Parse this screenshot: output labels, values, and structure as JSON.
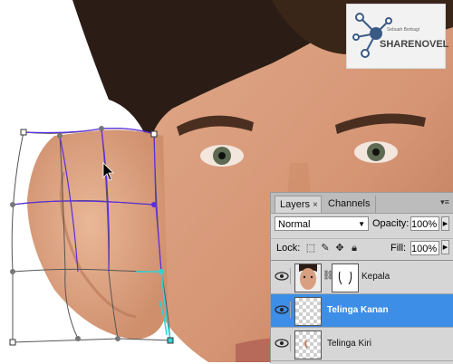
{
  "watermark": {
    "brand": "SHARENOVEL",
    "tagline": "Sebuah Berbagi"
  },
  "layers_panel": {
    "tabs": [
      {
        "label": "Layers",
        "close": "×"
      },
      {
        "label": "Channels"
      }
    ],
    "blend_mode": "Normal",
    "opacity_label": "Opacity:",
    "opacity_value": "100%",
    "lock_label": "Lock:",
    "fill_label": "Fill:",
    "fill_value": "100%",
    "layers": [
      {
        "name": "Kepala",
        "visible": true,
        "selected": false,
        "has_mask": true
      },
      {
        "name": "Telinga Kanan",
        "visible": true,
        "selected": true,
        "has_mask": false
      },
      {
        "name": "Telinga Kiri",
        "visible": true,
        "selected": false,
        "has_mask": false
      }
    ]
  },
  "colors": {
    "selection": "#3d8ee6",
    "panel_bg": "#d6d6d6",
    "warp_grid": "#555555",
    "warp_path": "#5a2de0",
    "warp_handle": "#2fd3d3"
  }
}
